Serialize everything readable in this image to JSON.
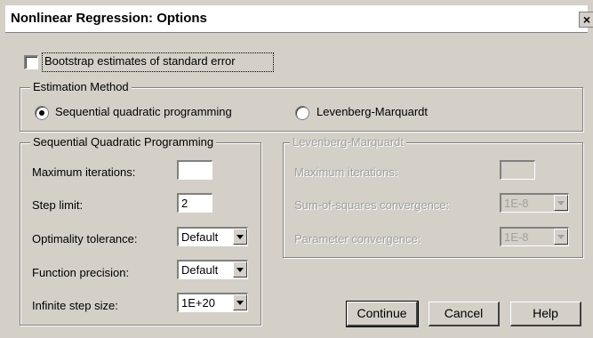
{
  "window": {
    "title": "Nonlinear Regression: Options",
    "close_glyph": "×"
  },
  "bootstrap": {
    "label": "Bootstrap estimates of standard error",
    "checked": false
  },
  "estimation_method": {
    "title": "Estimation Method",
    "options": [
      {
        "label": "Sequential quadratic programming",
        "selected": true
      },
      {
        "label": "Levenberg-Marquardt",
        "selected": false
      }
    ]
  },
  "sqp": {
    "title": "Sequential Quadratic Programming",
    "fields": {
      "max_iterations": {
        "label": "Maximum iterations:",
        "value": ""
      },
      "step_limit": {
        "label": "Step limit:",
        "value": "2"
      },
      "optimality_tolerance": {
        "label": "Optimality tolerance:",
        "value": "Default"
      },
      "function_precision": {
        "label": "Function precision:",
        "value": "Default"
      },
      "infinite_step_size": {
        "label": "Infinite step size:",
        "value": "1E+20"
      }
    }
  },
  "lm": {
    "title": "Levenberg-Marquardt",
    "fields": {
      "max_iterations": {
        "label": "Maximum iterations:",
        "value": ""
      },
      "ss_convergence": {
        "label": "Sum-of-squares convergence:",
        "value": "1E-8"
      },
      "param_convergence": {
        "label": "Parameter convergence:",
        "value": "1E-8"
      }
    }
  },
  "buttons": {
    "continue": "Continue",
    "cancel": "Cancel",
    "help": "Help"
  }
}
